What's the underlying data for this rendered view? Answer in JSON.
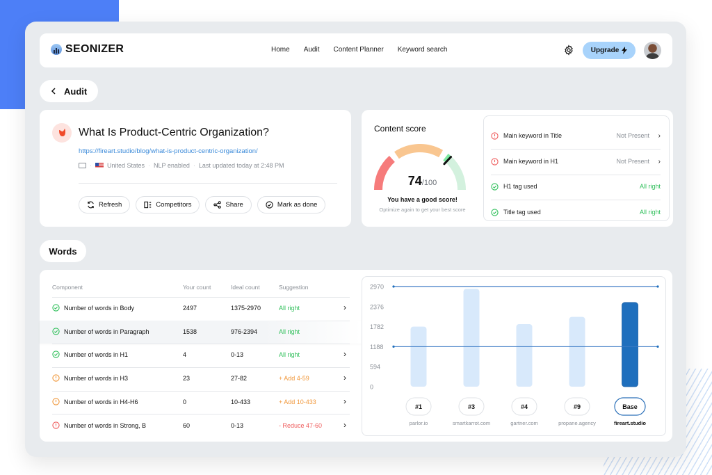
{
  "app": {
    "brand": "SEONIZER",
    "nav": [
      "Home",
      "Audit",
      "Content Planner",
      "Keyword search"
    ],
    "upgrade_label": "Upgrade",
    "icons": {
      "settings": "gear-icon",
      "upgrade": "lightning-icon",
      "avatar": "user-avatar"
    }
  },
  "breadcrumb": {
    "back_label": "Audit"
  },
  "article": {
    "title": "What Is Product-Centric Organization?",
    "url": "https://fireart.studio/blog/what-is-product-centric-organization/",
    "meta": {
      "country": "United States",
      "nlp": "NLP enabled",
      "updated": "Last updated today at 2:48 PM"
    },
    "actions": [
      "Refresh",
      "Competitors",
      "Share",
      "Mark as done"
    ]
  },
  "content_score": {
    "title": "Content score",
    "score": "74",
    "max": "/100",
    "score_value": 74,
    "message": "You have a good score!",
    "sub": "Optimize again to get your best score",
    "colors": {
      "bad": "#f67b7b",
      "mid": "#f9c690",
      "good": "#7fe9a2",
      "good_light": "#d3f1de"
    }
  },
  "checks": [
    {
      "label": "Main keyword in Title",
      "status": "Not Present",
      "state": "error",
      "has_chevron": true
    },
    {
      "label": "Main keyword in H1",
      "status": "Not Present",
      "state": "error",
      "has_chevron": true
    },
    {
      "label": "H1 tag used",
      "status": "All right",
      "state": "ok",
      "has_chevron": false
    },
    {
      "label": "Title tag used",
      "status": "All right",
      "state": "ok",
      "has_chevron": false
    }
  ],
  "words": {
    "section_title": "Words",
    "columns": [
      "Component",
      "Your count",
      "Ideal count",
      "Suggestion"
    ],
    "rows": [
      {
        "component": "Number of words in Body",
        "count": "2497",
        "ideal": "1375-2970",
        "suggestion": "All right",
        "state": "ok",
        "chevron": true
      },
      {
        "component": "Number of words in Paragraph",
        "count": "1538",
        "ideal": "976-2394",
        "suggestion": "All right",
        "state": "ok",
        "chevron": false
      },
      {
        "component": "Number of words in H1",
        "count": "4",
        "ideal": "0-13",
        "suggestion": "All right",
        "state": "ok",
        "chevron": true
      },
      {
        "component": "Number of words in H3",
        "count": "23",
        "ideal": "27-82",
        "suggestion": "+ Add 4-59",
        "state": "warn",
        "chevron": true
      },
      {
        "component": "Number of words in H4-H6",
        "count": "0",
        "ideal": "10-433",
        "suggestion": "+ Add 10-433",
        "state": "warn",
        "chevron": true
      },
      {
        "component": "Number of words in Strong, B",
        "count": "60",
        "ideal": "0-13",
        "suggestion": "- Reduce 47-60",
        "state": "bad",
        "chevron": true
      }
    ]
  },
  "chart_data": {
    "type": "bar",
    "title": "",
    "xlabel": "",
    "ylabel": "",
    "ylim": [
      0,
      2970
    ],
    "yticks": [
      2970,
      2376,
      1782,
      1188,
      594,
      0
    ],
    "categories": [
      "parlor.io",
      "smartkarrot.com",
      "gartner.com",
      "propane.agency",
      "fireart.studio"
    ],
    "ranks": [
      "#1",
      "#3",
      "#4",
      "#9",
      "Base"
    ],
    "values": [
      1782,
      2900,
      1855,
      2070,
      2497
    ],
    "highlight_index": 4,
    "reference_lines": [
      2970,
      1188
    ],
    "colors": {
      "bar": "#d8e9fb",
      "highlight": "#1f6fbd",
      "line": "#3d7bc5"
    },
    "grid": false,
    "legend": "none"
  }
}
